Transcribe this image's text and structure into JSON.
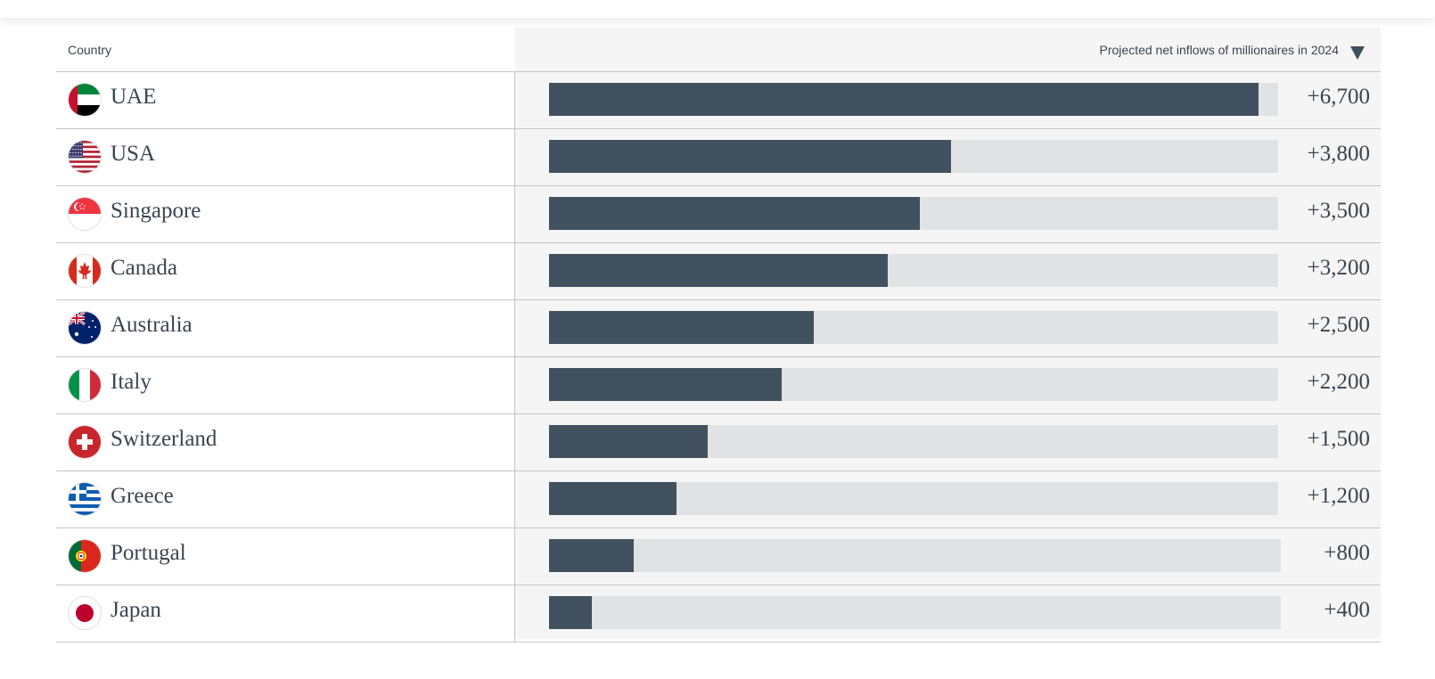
{
  "chart_data": {
    "type": "bar",
    "orientation": "horizontal",
    "title": "",
    "xlabel": "Projected net inflows of millionaires in 2024",
    "ylabel": "Country",
    "sort": "descending",
    "xlim": [
      0,
      6700
    ],
    "categories": [
      "UAE",
      "USA",
      "Singapore",
      "Canada",
      "Australia",
      "Italy",
      "Switzerland",
      "Greece",
      "Portugal",
      "Japan"
    ],
    "values": [
      6700,
      3800,
      3500,
      3200,
      2500,
      2200,
      1500,
      1200,
      800,
      400
    ],
    "labels": [
      "+6,700",
      "+3,800",
      "+3,500",
      "+3,200",
      "+2,500",
      "+2,200",
      "+1,500",
      "+1,200",
      "+800",
      "+400"
    ],
    "colors": {
      "bar": "#415160",
      "track": "#e1e2e3",
      "text": "#3a4550"
    }
  },
  "header": {
    "country_label": "Country",
    "metric_label": "Projected net inflows of millionaires in 2024",
    "sort_icon": "triangle-down-icon"
  },
  "rows": [
    {
      "country": "UAE",
      "flag": "uae",
      "value": 6700,
      "label": "+6,700"
    },
    {
      "country": "USA",
      "flag": "usa",
      "value": 3800,
      "label": "+3,800"
    },
    {
      "country": "Singapore",
      "flag": "singapore",
      "value": 3500,
      "label": "+3,500"
    },
    {
      "country": "Canada",
      "flag": "canada",
      "value": 3200,
      "label": "+3,200"
    },
    {
      "country": "Australia",
      "flag": "australia",
      "value": 2500,
      "label": "+2,500"
    },
    {
      "country": "Italy",
      "flag": "italy",
      "value": 2200,
      "label": "+2,200"
    },
    {
      "country": "Switzerland",
      "flag": "switzerland",
      "value": 1500,
      "label": "+1,500"
    },
    {
      "country": "Greece",
      "flag": "greece",
      "value": 1200,
      "label": "+1,200"
    },
    {
      "country": "Portugal",
      "flag": "portugal",
      "value": 800,
      "label": "+800"
    },
    {
      "country": "Japan",
      "flag": "japan",
      "value": 400,
      "label": "+400"
    }
  ]
}
